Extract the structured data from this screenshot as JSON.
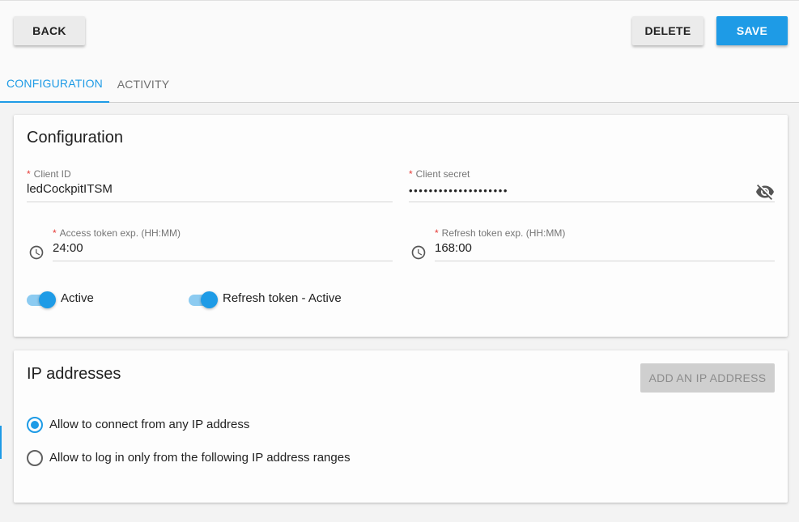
{
  "toolbar": {
    "back_label": "BACK",
    "delete_label": "DELETE",
    "save_label": "SAVE"
  },
  "tabs": [
    {
      "label": "CONFIGURATION",
      "active": true
    },
    {
      "label": "ACTIVITY",
      "active": false
    }
  ],
  "configuration": {
    "title": "Configuration",
    "client_id": {
      "label": "Client ID",
      "required": true,
      "value": "ledCockpitITSM"
    },
    "client_secret": {
      "label": "Client secret",
      "required": true,
      "value": "••••••••••••••••••••",
      "visibility_icon": "eye-off-icon"
    },
    "access_token_exp": {
      "label": "Access token exp. (HH:MM)",
      "required": true,
      "value": "24:00",
      "icon": "clock-icon"
    },
    "refresh_token_exp": {
      "label": "Refresh token exp. (HH:MM)",
      "required": true,
      "value": "168:00",
      "icon": "clock-icon"
    },
    "toggles": [
      {
        "label": "Active",
        "on": true
      },
      {
        "label": "Refresh token - Active",
        "on": true
      }
    ]
  },
  "ip_addresses": {
    "title": "IP addresses",
    "add_button_label": "ADD AN IP ADDRESS",
    "add_button_disabled": true,
    "options": [
      {
        "label": "Allow to connect from any IP address",
        "selected": true
      },
      {
        "label": "Allow to log in only from the following IP address ranges",
        "selected": false
      }
    ]
  },
  "colors": {
    "accent": "#1e9be6",
    "required_marker": "#e53935",
    "disabled_button": "#cfcfcf"
  }
}
